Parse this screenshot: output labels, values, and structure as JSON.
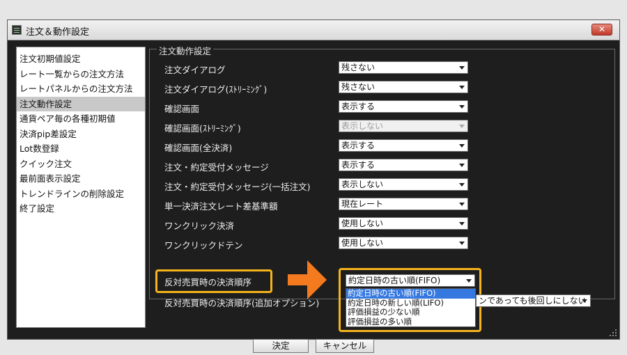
{
  "window": {
    "title": "注文＆動作設定",
    "close_label": "✕"
  },
  "nav": {
    "items": [
      {
        "label": "注文初期値設定",
        "selected": false
      },
      {
        "label": "レート一覧からの注文方法",
        "selected": false
      },
      {
        "label": "レートパネルからの注文方法",
        "selected": false
      },
      {
        "label": "注文動作設定",
        "selected": true
      },
      {
        "label": "通貨ペア毎の各種初期値",
        "selected": false
      },
      {
        "label": "決済pip差設定",
        "selected": false
      },
      {
        "label": "Lot数登録",
        "selected": false
      },
      {
        "label": "クイック注文",
        "selected": false
      },
      {
        "label": "最前面表示設定",
        "selected": false
      },
      {
        "label": "トレンドラインの削除設定",
        "selected": false
      },
      {
        "label": "終了設定",
        "selected": false
      }
    ]
  },
  "group": {
    "title": "注文動作設定",
    "settings": [
      {
        "label": "注文ダイアログ",
        "value": "残さない",
        "enabled": true
      },
      {
        "label": "注文ダイアログ(ｽﾄﾘｰﾐﾝｸﾞ)",
        "value": "残さない",
        "enabled": true
      },
      {
        "label": "確認画面",
        "value": "表示する",
        "enabled": true
      },
      {
        "label": "確認画面(ｽﾄﾘｰﾐﾝｸﾞ)",
        "value": "表示しない",
        "enabled": false
      },
      {
        "label": "確認画面(全決済)",
        "value": "表示する",
        "enabled": true
      },
      {
        "label": "注文・約定受付メッセージ",
        "value": "表示する",
        "enabled": true
      },
      {
        "label": "注文・約定受付メッセージ(一括注文)",
        "value": "表示しない",
        "enabled": true
      },
      {
        "label": "単一決済注文レート差基準額",
        "value": "現在レート",
        "enabled": true
      },
      {
        "label": "ワンクリック決済",
        "value": "使用しない",
        "enabled": true
      },
      {
        "label": "ワンクリックドテン",
        "value": "使用しない",
        "enabled": true
      }
    ],
    "settlement_order": {
      "label": "反対売買時の決済順序",
      "value": "約定日時の古い順(FIFO)",
      "options": [
        {
          "label": "約定日時の古い順(FIFO)",
          "selected": true
        },
        {
          "label": "約定日時の新しい順(LIFO)",
          "selected": false
        },
        {
          "label": "評価損益の少ない順",
          "selected": false
        },
        {
          "label": "評価損益の多い順",
          "selected": false
        }
      ]
    },
    "settlement_option": {
      "label": "反対売買時の決済順序(追加オプション)",
      "value": "ンであっても後回しにしない"
    }
  },
  "footer": {
    "ok_label": "決定",
    "cancel_label": "キャンセル"
  },
  "colors": {
    "highlight": "#f5b31c",
    "arrow": "#f47a1f",
    "selection": "#3478e0",
    "panel_bg": "#1e1e1e"
  }
}
